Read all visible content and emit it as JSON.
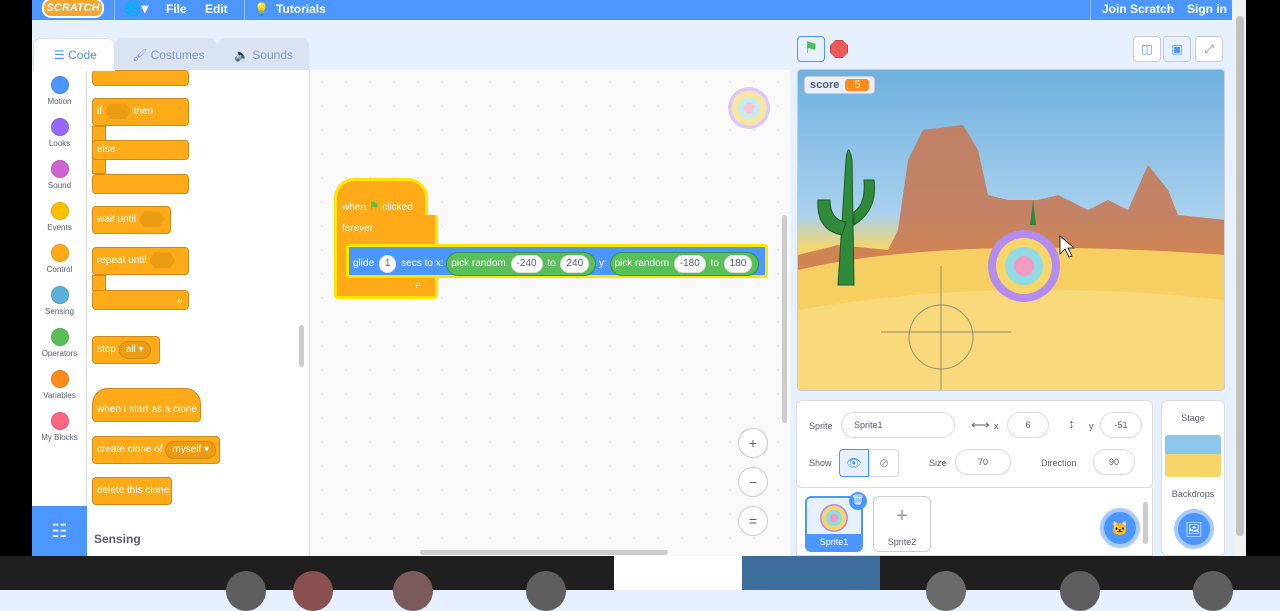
{
  "menubar": {
    "logo": "SCRATCH",
    "file": "File",
    "edit": "Edit",
    "tutorials": "Tutorials",
    "join": "Join Scratch",
    "signin": "Sign in"
  },
  "tabs": {
    "code": "Code",
    "costumes": "Costumes",
    "sounds": "Sounds"
  },
  "categories": [
    {
      "label": "Motion",
      "color": "#4c97ff"
    },
    {
      "label": "Looks",
      "color": "#9966ff"
    },
    {
      "label": "Sound",
      "color": "#cf63cf"
    },
    {
      "label": "Events",
      "color": "#ffbf00"
    },
    {
      "label": "Control",
      "color": "#ffab19"
    },
    {
      "label": "Sensing",
      "color": "#5cb1d6"
    },
    {
      "label": "Operators",
      "color": "#59c059"
    },
    {
      "label": "Variables",
      "color": "#ff8c1a"
    },
    {
      "label": "My Blocks",
      "color": "#ff6680"
    }
  ],
  "palette": {
    "if": "if",
    "then": "then",
    "else": "else",
    "wait_until": "wait until",
    "repeat_until": "repeat until",
    "stop": "stop",
    "stop_all": "all",
    "start_clone": "when I start as a clone",
    "create_clone": "create clone of",
    "myself": "myself",
    "delete_clone": "delete this clone",
    "section_label": "Sensing"
  },
  "script": {
    "when": "when",
    "clicked": "clicked",
    "forever": "forever",
    "glide": "glide",
    "secs": "1",
    "secs_to_x": "secs to x:",
    "pick_random": "pick random",
    "x_min": "-240",
    "to": "to",
    "x_max": "240",
    "y_label": "y:",
    "y_min": "-180",
    "y_max": "180"
  },
  "zoom": {
    "in": "+",
    "out": "−",
    "reset": "="
  },
  "stage": {
    "score_label": "score",
    "score_value": "5"
  },
  "sprite_info": {
    "sprite_label": "Sprite",
    "sprite_name": "Sprite1",
    "x_label": "x",
    "x_value": "6",
    "y_label": "y",
    "y_value": "-51",
    "show_label": "Show",
    "size_label": "Size",
    "size_value": "70",
    "direction_label": "Direction",
    "direction_value": "90"
  },
  "sprites": [
    {
      "name": "Sprite1"
    },
    {
      "name": "Sprite2"
    }
  ],
  "stage_panel": {
    "title": "Stage",
    "backdrops_label": "Backdrops"
  }
}
